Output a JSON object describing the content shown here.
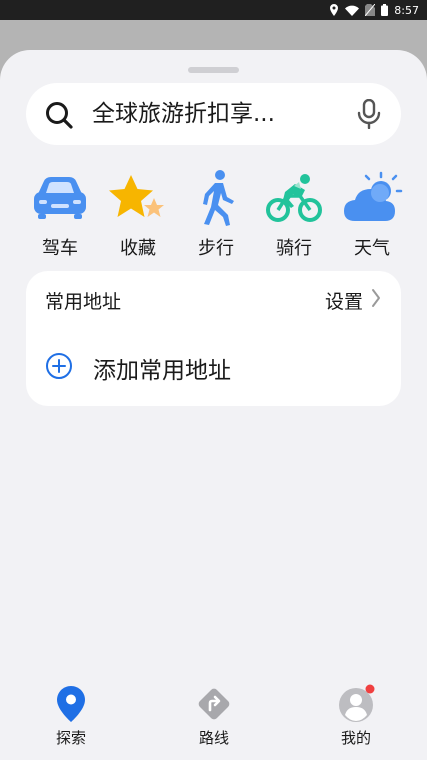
{
  "status_bar": {
    "time": "8:57",
    "icons": [
      "location-icon",
      "wifi-icon",
      "no-sim-icon",
      "battery-icon"
    ]
  },
  "search": {
    "text": "全球旅游折扣享...",
    "icons": [
      "search-icon",
      "mic-icon"
    ]
  },
  "shortcuts": [
    {
      "label": "驾车",
      "icon": "car-icon",
      "color": "#4a90f0"
    },
    {
      "label": "收藏",
      "icon": "star-icon",
      "color": "#f7b500"
    },
    {
      "label": "步行",
      "icon": "walk-icon",
      "color": "#4a90f0"
    },
    {
      "label": "骑行",
      "icon": "bike-icon",
      "color": "#22c39b"
    },
    {
      "label": "天气",
      "icon": "weather-icon",
      "color": "#4a90f0"
    }
  ],
  "common_address": {
    "title": "常用地址",
    "settings_label": "设置",
    "add_label": "添加常用地址"
  },
  "bottom_nav": [
    {
      "label": "探索",
      "icon": "location-pin-icon",
      "active": true
    },
    {
      "label": "路线",
      "icon": "route-icon",
      "active": false
    },
    {
      "label": "我的",
      "icon": "avatar-icon",
      "active": false,
      "badge": true
    }
  ],
  "colors": {
    "accent": "#1f6fe5",
    "badge": "#f04040",
    "sheet_bg": "#f2f2f5"
  }
}
